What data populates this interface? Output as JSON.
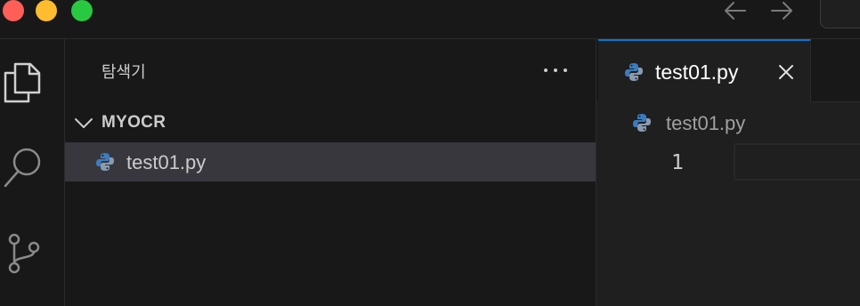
{
  "sidebar": {
    "title": "탐색기",
    "folder_name": "MYOCR",
    "files": [
      {
        "name": "test01.py",
        "icon": "python-icon",
        "selected": true
      }
    ]
  },
  "editor": {
    "tab": {
      "label": "test01.py",
      "icon": "python-icon",
      "active": true
    },
    "breadcrumb": "test01.py",
    "line_numbers": [
      "1"
    ]
  },
  "icons": {
    "activity_bar": [
      "explorer-icon",
      "search-icon",
      "source-control-icon"
    ],
    "titlebar": [
      "back-arrow-icon",
      "forward-arrow-icon"
    ]
  },
  "colors": {
    "accent": "#0078d4",
    "python_blue": "#3b7cc0",
    "python_gray": "#8a9bb0",
    "traffic_red": "#ff5f57",
    "traffic_yellow": "#febc2e",
    "traffic_green": "#28c840"
  }
}
